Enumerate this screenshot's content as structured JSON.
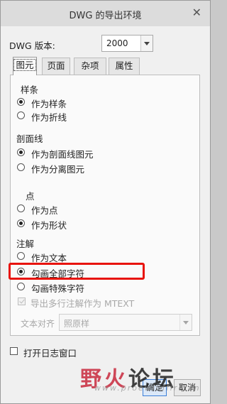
{
  "window": {
    "title": "DWG 的导出环境",
    "close_glyph": "✕"
  },
  "version": {
    "label": "DWG 版本:",
    "value": "2000"
  },
  "tabs": [
    {
      "label": "图元"
    },
    {
      "label": "页面"
    },
    {
      "label": "杂项"
    },
    {
      "label": "属性"
    }
  ],
  "spline": {
    "header": "样条",
    "opt1": "作为样条",
    "opt2": "作为折线",
    "selected": "作为样条"
  },
  "hatch": {
    "header": "剖面线",
    "opt1": "作为剖面线图元",
    "opt2": "作为分离图元",
    "selected": "作为剖面线图元"
  },
  "point": {
    "header": "点",
    "opt1": "作为点",
    "opt2": "作为形状",
    "selected": "作为形状"
  },
  "note": {
    "header": "注解",
    "opt1": "作为文本",
    "opt2": "勾画全部字符",
    "opt3": "勾画特殊字符",
    "selected": "勾画全部字符",
    "mtext_checkbox": "导出多行注解作为 MTEXT",
    "align_label": "文本对齐",
    "align_value": "照原样"
  },
  "log_checkbox": "打开日志窗口",
  "buttons": {
    "ok": "确定",
    "cancel": "取消"
  },
  "watermark": {
    "text1": "野火",
    "text2": "论坛",
    "url": "www.proewildfire.cn"
  },
  "colors": {
    "highlight": "#e8130b",
    "accent": "#3c7fd8"
  }
}
